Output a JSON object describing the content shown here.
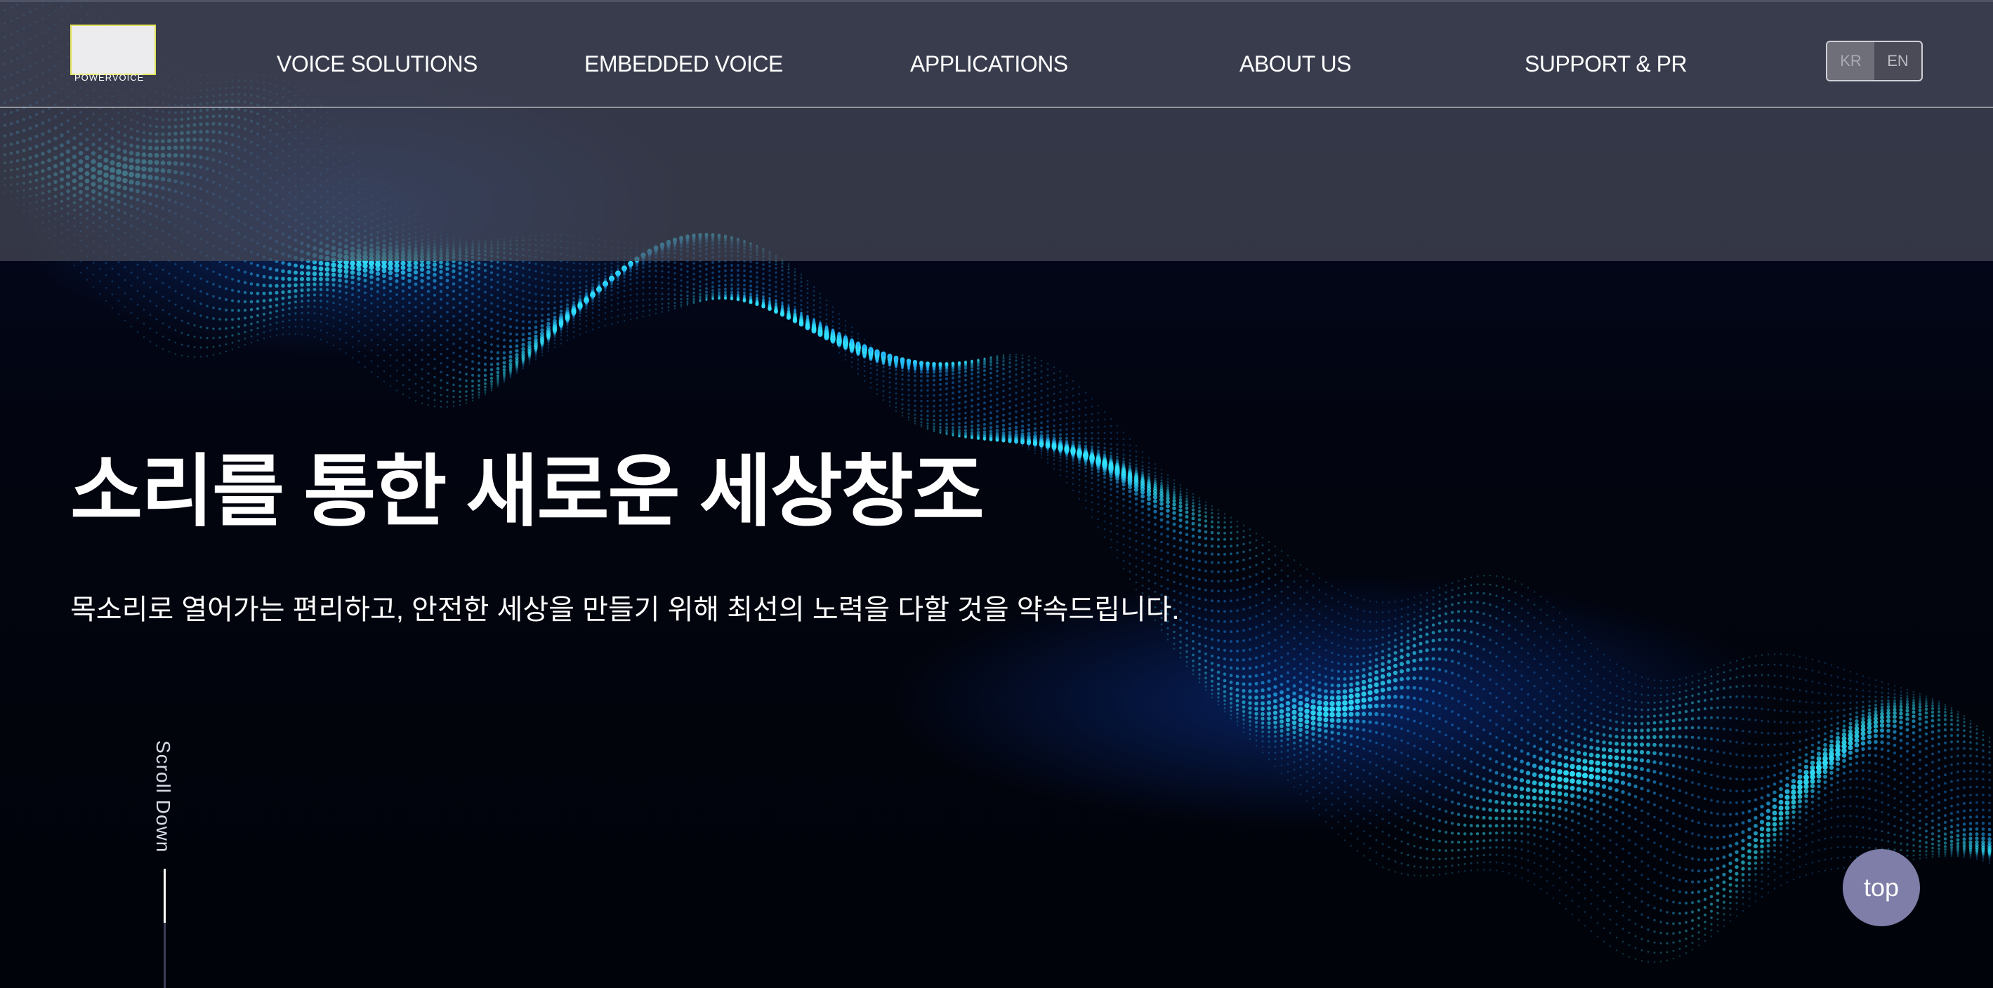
{
  "logo": {
    "text": "POWERVOICE"
  },
  "nav": [
    {
      "label": "VOICE SOLUTIONS"
    },
    {
      "label": "EMBEDDED VOICE"
    },
    {
      "label": "APPLICATIONS"
    },
    {
      "label": "ABOUT US"
    },
    {
      "label": "SUPPORT & PR"
    }
  ],
  "lang": {
    "kr": "KR",
    "en": "EN",
    "selected": "KR"
  },
  "hero": {
    "title": "소리를 통한 새로운 세상창조",
    "subtitle": "목소리로 열어가는 편리하고, 안전한 세상을 만들기 위해 최선의 노력을 다할 것을 약속드립니다."
  },
  "scroll": {
    "label": "Scroll Down"
  },
  "top_button": {
    "label": "top"
  },
  "colors": {
    "background": "#02040f",
    "accent": "#1fd0ff",
    "header": "#484a58",
    "top_button": "#7e7ea8"
  }
}
